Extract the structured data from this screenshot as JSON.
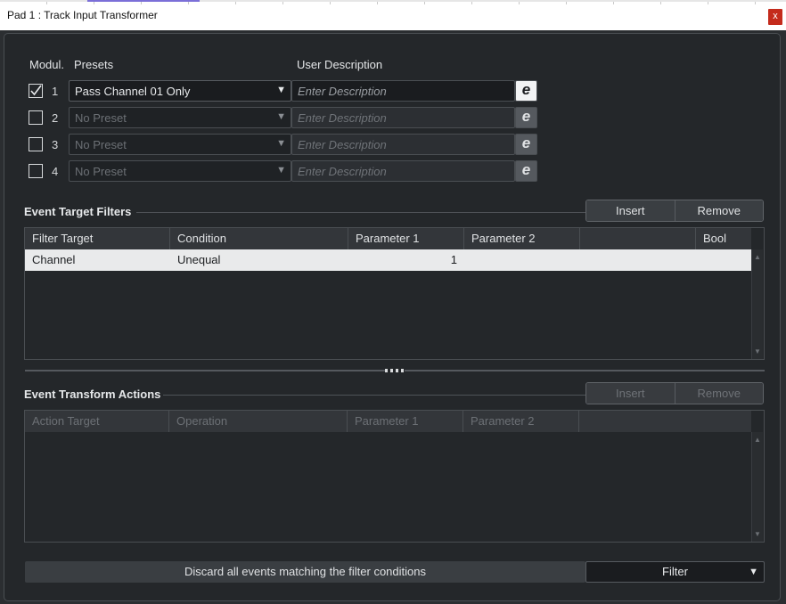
{
  "window": {
    "title": "Pad 1 : Track Input Transformer",
    "close_label": "x"
  },
  "modules": {
    "headers": {
      "module": "Modul.",
      "presets": "Presets",
      "description": "User Description"
    },
    "rows": [
      {
        "checked": true,
        "number": "1",
        "preset": "Pass Channel 01 Only",
        "description_placeholder": "Enter Description",
        "edit_icon": "e-edit-icon"
      },
      {
        "checked": false,
        "number": "2",
        "preset": "No Preset",
        "description_placeholder": "Enter Description",
        "edit_icon": "e-edit-icon"
      },
      {
        "checked": false,
        "number": "3",
        "preset": "No Preset",
        "description_placeholder": "Enter Description",
        "edit_icon": "e-edit-icon"
      },
      {
        "checked": false,
        "number": "4",
        "preset": "No Preset",
        "description_placeholder": "Enter Description",
        "edit_icon": "e-edit-icon"
      }
    ]
  },
  "filters": {
    "title": "Event Target Filters",
    "insert_label": "Insert",
    "remove_label": "Remove",
    "columns": [
      "Filter Target",
      "Condition",
      "Parameter 1",
      "Parameter 2",
      "",
      "Bool"
    ],
    "rows": [
      {
        "target": "Channel",
        "condition": "Unequal",
        "param1": "1",
        "param2": "",
        "extra": "",
        "bool": ""
      }
    ]
  },
  "actions": {
    "title": "Event Transform Actions",
    "insert_label": "Insert",
    "remove_label": "Remove",
    "columns": [
      "Action Target",
      "Operation",
      "Parameter 1",
      "Parameter 2",
      ""
    ]
  },
  "footer": {
    "description": "Discard all events matching the filter conditions",
    "mode": "Filter"
  },
  "colors": {
    "accent": "#7b6fd8",
    "close": "#c42b1c",
    "selected_row": "#e9eaeb"
  }
}
